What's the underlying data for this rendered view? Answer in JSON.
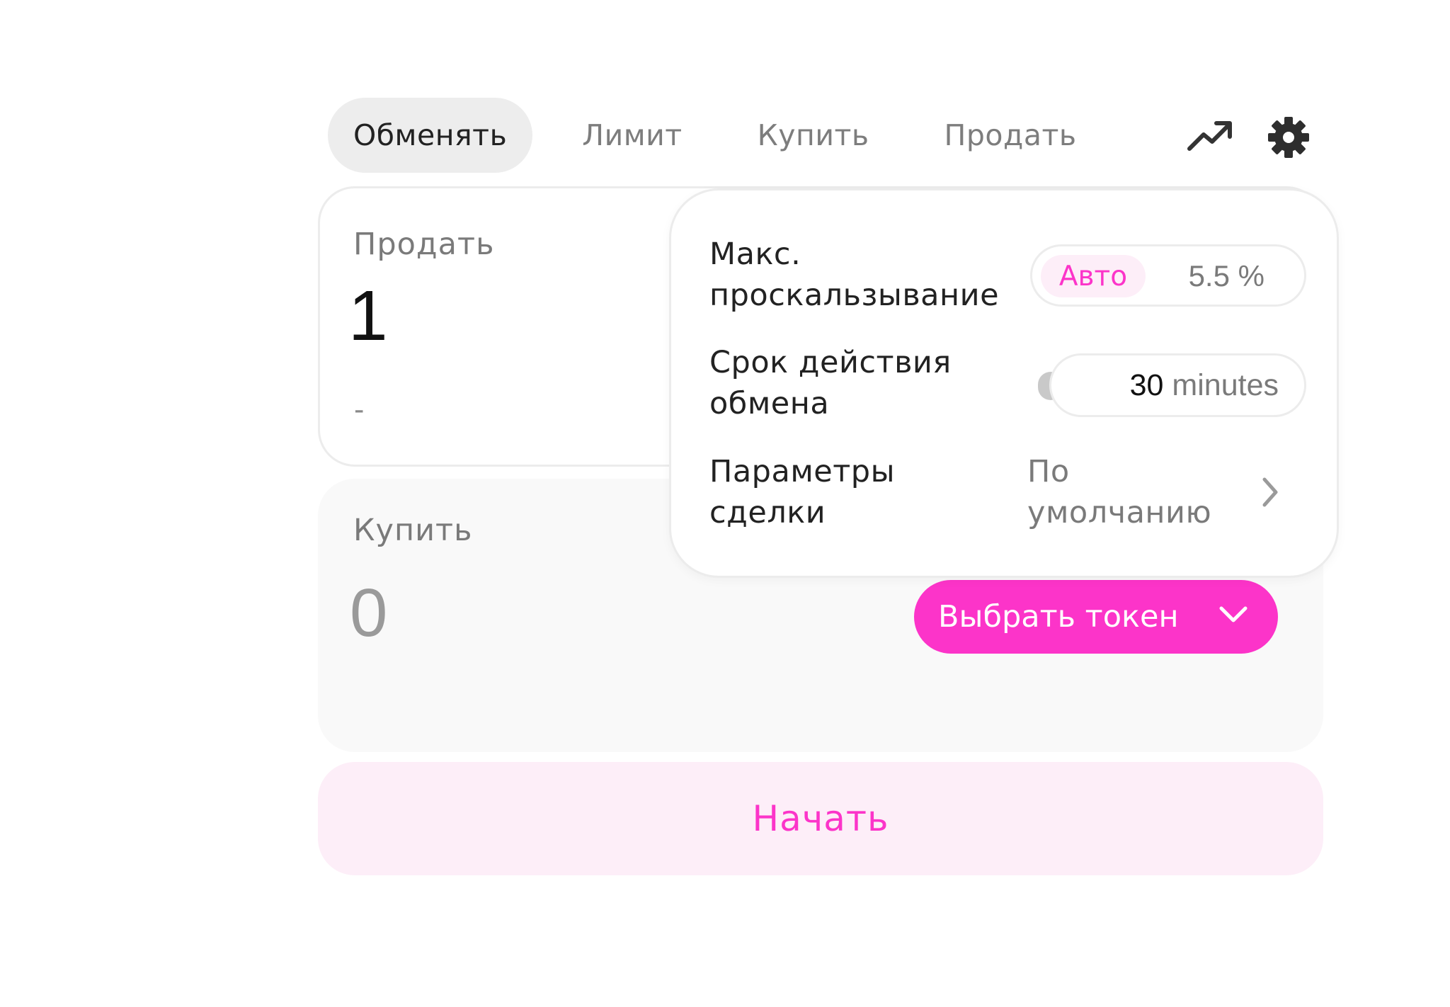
{
  "tabs": {
    "swap": "Обменять",
    "limit": "Лимит",
    "buy": "Купить",
    "sell": "Продать"
  },
  "icons": {
    "chart": "trending-up-icon",
    "settings": "gear-icon"
  },
  "sell_card": {
    "label": "Продать",
    "amount": "1",
    "usd_value": "-"
  },
  "buy_card": {
    "label": "Купить",
    "amount": "0",
    "token_button": "Выбрать токен"
  },
  "start_button": "Начать",
  "settings": {
    "slippage": {
      "label_line1": "Макс.",
      "label_line2": "проскальзывание",
      "auto_label": "Авто",
      "value": "5.5",
      "unit": "%"
    },
    "deadline": {
      "label_line1": "Срок действия",
      "label_line2": "обмена",
      "value": "30",
      "unit": "minutes"
    },
    "trade_options": {
      "label_line1": "Параметры",
      "label_line2": "сделки",
      "value_line1": "По",
      "value_line2": "умолчанию"
    }
  },
  "colors": {
    "accent": "#fc34c9",
    "accent_soft": "#fdeef8",
    "tab_active_bg": "#ededed",
    "buy_card_bg": "#f9f9f9"
  }
}
